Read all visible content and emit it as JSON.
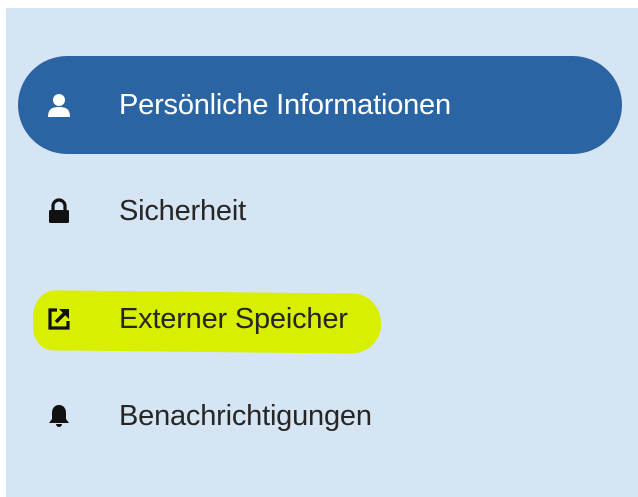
{
  "nav": {
    "items": [
      {
        "label": "Persönliche Informationen",
        "icon": "user-icon",
        "active": true
      },
      {
        "label": "Sicherheit",
        "icon": "lock-icon",
        "active": false
      },
      {
        "label": "Externer Speicher",
        "icon": "external-link-icon",
        "active": false,
        "highlighted": true
      },
      {
        "label": "Benachrichtigungen",
        "icon": "bell-icon",
        "active": false
      }
    ]
  },
  "colors": {
    "panel_background": "#d6e5f3",
    "active_background": "#2a64a3",
    "active_text": "#ffffff",
    "text": "#262626",
    "highlight": "#d9ef00"
  }
}
